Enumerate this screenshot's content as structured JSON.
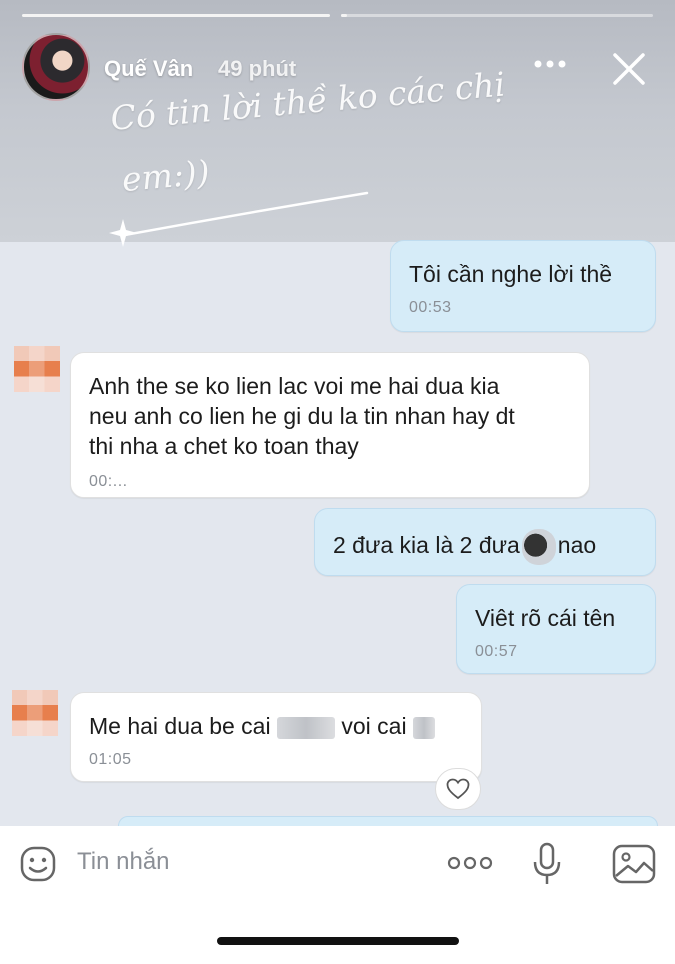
{
  "story": {
    "username": "Quế Vân",
    "time_ago": "49 phút",
    "caption_line1": "Có tin lời thề ko các chị",
    "caption_line2": "em:))"
  },
  "messages": [
    {
      "direction": "out",
      "text": "Tôi cần nghe lời thề",
      "time": "00:53"
    },
    {
      "direction": "in",
      "lines": [
        "Anh the se ko lien lac voi me hai dua kia",
        "neu anh co lien he gi du la tin nhan hay dt",
        "thi nha a chet ko toan thay"
      ],
      "time": "00:..."
    },
    {
      "direction": "out",
      "text_before": "2 đưa kia là 2 đưa",
      "text_after": "nao"
    },
    {
      "direction": "out",
      "text": "Viêt rõ cái tên",
      "time": "00:57"
    },
    {
      "direction": "in",
      "text_before": "Me hai dua be cai",
      "text_middle": "voi cai",
      "time": "01:05"
    }
  ],
  "composer": {
    "placeholder": "Tin nhắn"
  },
  "icons": {
    "more": "more-icon",
    "close": "close-icon",
    "like": "heart-icon",
    "emoji": "emoji-icon",
    "attachments": "dots-icon",
    "mic": "mic-icon",
    "gallery": "image-icon"
  }
}
